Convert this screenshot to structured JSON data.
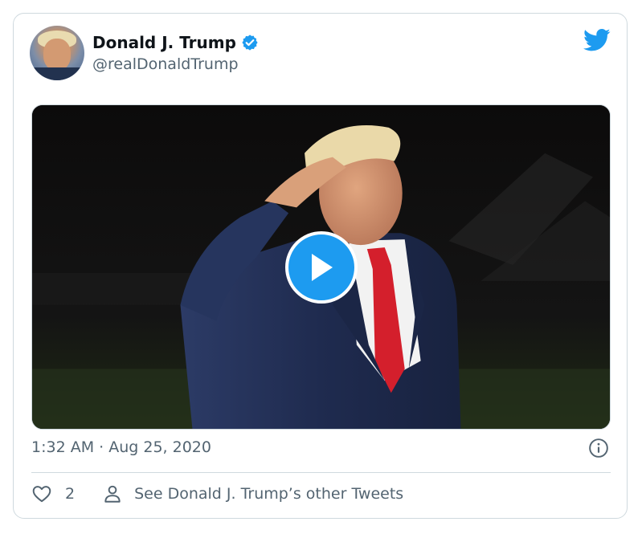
{
  "tweet": {
    "display_name": "Donald J. Trump",
    "handle": "@realDonaldTrump",
    "timestamp": "1:32 AM · Aug 25, 2020",
    "like_count": "2",
    "other_tweets_label": "See Donald J. Trump’s other Tweets"
  },
  "icons": {
    "verified": "verified-badge-icon",
    "brand": "twitter-bird-icon",
    "play": "play-icon",
    "info": "info-icon",
    "like": "heart-icon",
    "profile": "person-icon"
  },
  "colors": {
    "accent": "#1d9bf0",
    "text_primary": "#0f1419",
    "text_secondary": "#536471",
    "border": "#cfd9de"
  }
}
